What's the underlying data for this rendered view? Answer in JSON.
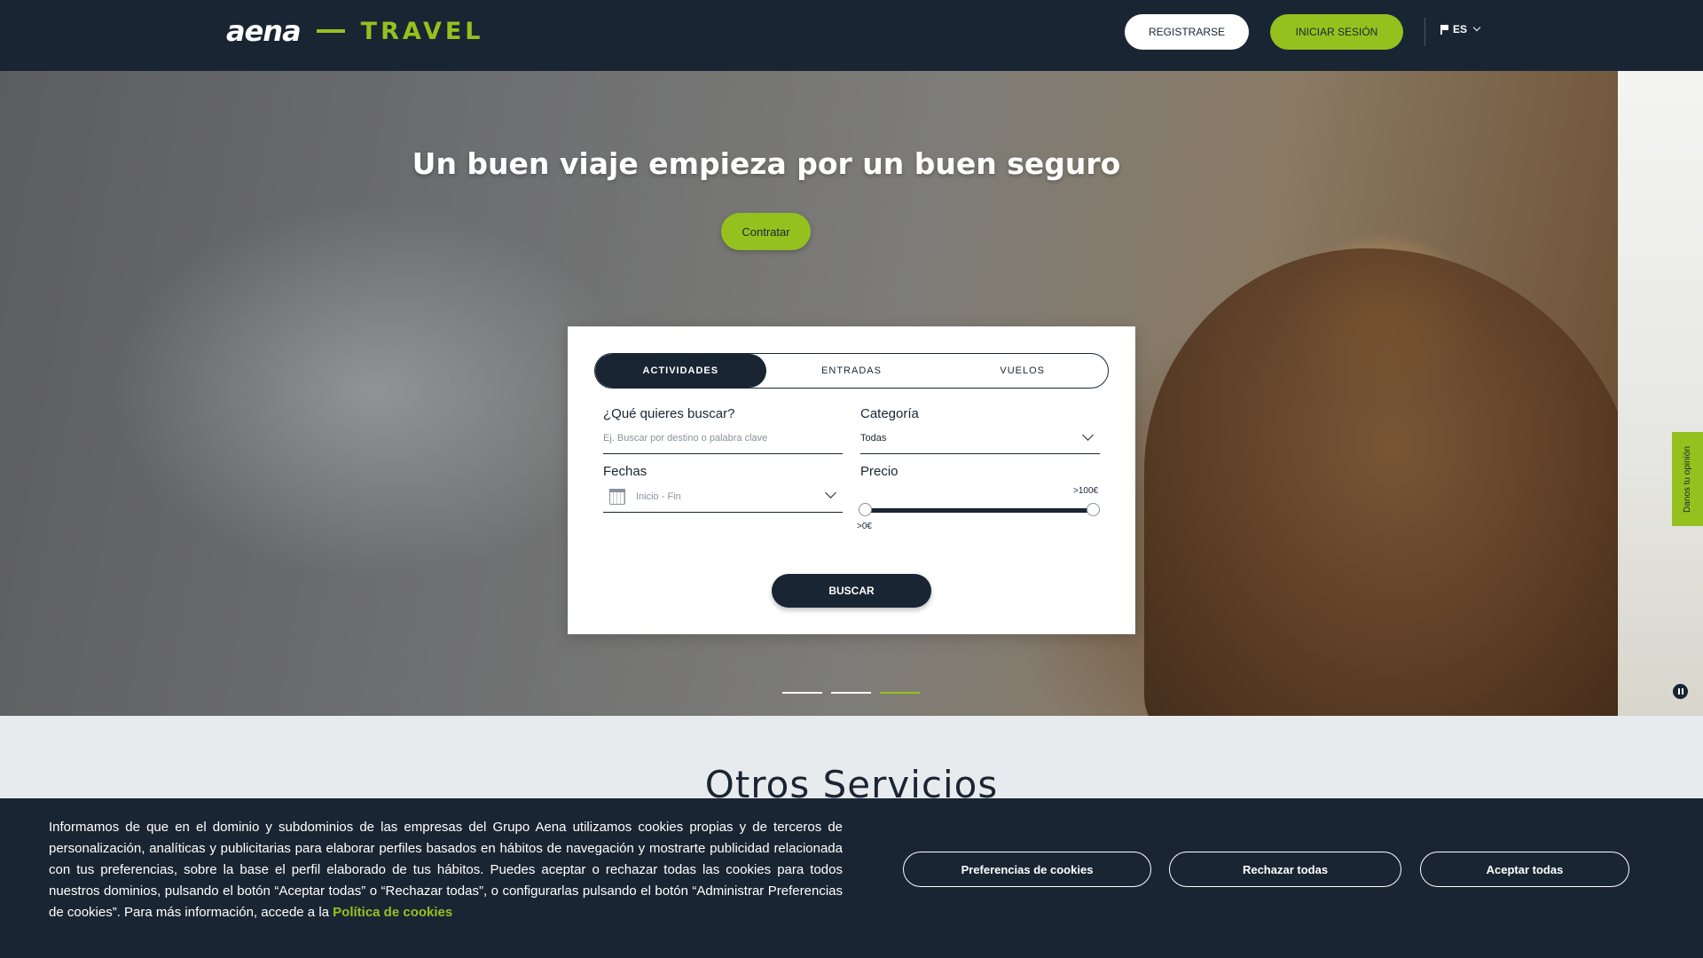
{
  "header": {
    "logo_main": "aena",
    "logo_sub": "TRAVEL",
    "register_label": "REGISTRARSE",
    "login_label": "INICIAR SESIÓN",
    "language": "ES"
  },
  "hero": {
    "title": "Un buen viaje empieza por un buen seguro",
    "cta_label": "Contratar",
    "slides_total": 3,
    "active_slide": 3
  },
  "search": {
    "tabs": [
      {
        "label": "ACTIVIDADES",
        "active": true
      },
      {
        "label": "ENTRADAS",
        "active": false
      },
      {
        "label": "VUELOS",
        "active": false
      }
    ],
    "query_label": "¿Qué quieres buscar?",
    "query_placeholder": "Ej. Buscar por destino o palabra clave",
    "category_label": "Categoría",
    "category_value": "Todas",
    "dates_label": "Fechas",
    "dates_placeholder": "Inicio - Fin",
    "price_label": "Precio",
    "price_min": ">0€",
    "price_max": ">100€",
    "search_button": "BUSCAR"
  },
  "feedback_tab": "Danos tu opinión",
  "otros_servicios": {
    "title": "Otros Servicios"
  },
  "cookie_banner": {
    "text": "Informamos de que en el dominio y subdominios de las empresas del Grupo Aena utilizamos cookies propias y de terceros de personalización, analíticas y publicitarias para elaborar perfiles basados en hábitos de navegación y mostrarte publicidad relacionada con tus preferencias, sobre la base el perfil elaborado de tus hábitos. Puedes aceptar o rechazar todas las cookies para todos nuestros dominios, pulsando el botón “Aceptar todas” o “Rechazar todas”, o configurarlas pulsando el botón “Administrar Preferencias de cookies”. Para más información, accede a la ",
    "link_text": "Política de cookies",
    "preferences_button": "Preferencias de cookies",
    "reject_button": "Rechazar todas",
    "accept_button": "Aceptar todas"
  },
  "colors": {
    "navy": "#1a2533",
    "lime": "#95c11f"
  }
}
